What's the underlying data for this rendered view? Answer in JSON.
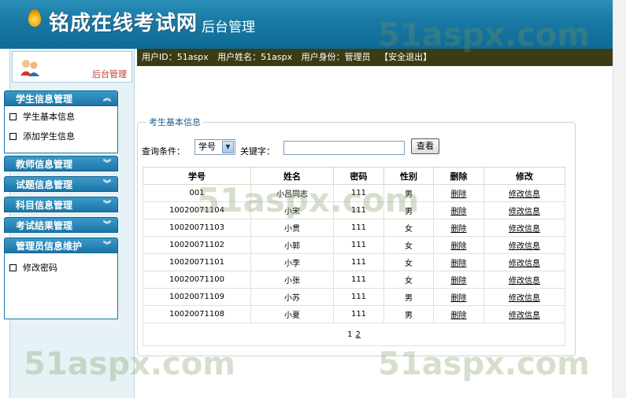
{
  "header": {
    "site_title": "铭成在线考试网",
    "sub_title": "后台管理"
  },
  "sidebar": {
    "admin_label": "后台管理",
    "groups": [
      {
        "title": "学生信息管理",
        "expanded": true,
        "items": [
          "学生基本信息",
          "添加学生信息"
        ]
      },
      {
        "title": "教师信息管理",
        "expanded": false,
        "items": []
      },
      {
        "title": "试题信息管理",
        "expanded": false,
        "items": []
      },
      {
        "title": "科目信息管理",
        "expanded": false,
        "items": []
      },
      {
        "title": "考试结果管理",
        "expanded": false,
        "items": []
      },
      {
        "title": "管理员信息维护",
        "expanded": true,
        "items": [
          "修改密码"
        ]
      }
    ]
  },
  "info_bar": {
    "user_id": "用户ID：51aspx",
    "user_name": "用户姓名：51aspx",
    "user_role": "用户身份：管理员",
    "logout": "【安全退出】"
  },
  "panel": {
    "legend": "考生基本信息",
    "query_label": "查询条件：",
    "select_value": "学号",
    "keyword_label": "关键字：",
    "keyword_value": "",
    "search_button": "查看"
  },
  "table": {
    "headers": [
      "学号",
      "姓名",
      "密码",
      "性别",
      "删除",
      "修改"
    ],
    "rows": [
      {
        "id": "001",
        "name": "小吕同志",
        "pwd": "111",
        "sex": "男",
        "del": "删除",
        "edit": "修改信息"
      },
      {
        "id": "10020071104",
        "name": "小宋",
        "pwd": "111",
        "sex": "男",
        "del": "删除",
        "edit": "修改信息"
      },
      {
        "id": "10020071103",
        "name": "小贯",
        "pwd": "111",
        "sex": "女",
        "del": "删除",
        "edit": "修改信息"
      },
      {
        "id": "10020071102",
        "name": "小郭",
        "pwd": "111",
        "sex": "女",
        "del": "删除",
        "edit": "修改信息"
      },
      {
        "id": "10020071101",
        "name": "小李",
        "pwd": "111",
        "sex": "女",
        "del": "删除",
        "edit": "修改信息"
      },
      {
        "id": "10020071100",
        "name": "小张",
        "pwd": "111",
        "sex": "女",
        "del": "删除",
        "edit": "修改信息"
      },
      {
        "id": "10020071109",
        "name": "小苏",
        "pwd": "111",
        "sex": "男",
        "del": "删除",
        "edit": "修改信息"
      },
      {
        "id": "10020071108",
        "name": "小夏",
        "pwd": "111",
        "sex": "男",
        "del": "删除",
        "edit": "修改信息"
      }
    ],
    "pager": {
      "current": "1",
      "next": "2"
    }
  },
  "watermark": "51aspx.com",
  "colors": {
    "header": "#1a7aa5",
    "menu_head": "#1d76a8",
    "info_bar": "#3c3c14",
    "sidebar_bg": "#e7f2f7"
  }
}
